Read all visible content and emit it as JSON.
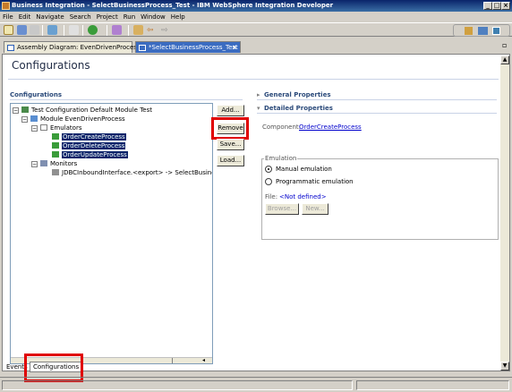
{
  "window": {
    "title": "Business Integration - SelectBusinessProcess_Test - IBM WebSphere Integration Developer",
    "controls": [
      "_",
      "□",
      "×"
    ]
  },
  "menu": [
    "File",
    "Edit",
    "Navigate",
    "Search",
    "Project",
    "Run",
    "Window",
    "Help"
  ],
  "tabs": [
    {
      "label": "Assembly Diagram: EvenDrivenProcess",
      "active": false
    },
    {
      "label": "*SelectBusinessProcess_Test",
      "active": true
    }
  ],
  "editor": {
    "page_title": "Configurations",
    "tree_section_label": "Configurations",
    "tree": [
      {
        "label": "Test Configuration Default Module Test",
        "icon": "config-icon",
        "expander": "⊟"
      },
      {
        "label": "Module EvenDrivenProcess",
        "icon": "module-icon",
        "expander": "⊟"
      },
      {
        "label": "Emulators",
        "icon": "folder-icon",
        "expander": "⊟"
      },
      {
        "label": "OrderCreateProcess",
        "icon": "emulator-icon",
        "selected": true
      },
      {
        "label": "OrderDeleteProcess",
        "icon": "emulator-icon",
        "selected": true
      },
      {
        "label": "OrderUpdateProcess",
        "icon": "emulator-icon",
        "selected": true
      },
      {
        "label": "Monitors",
        "icon": "monitor-icon",
        "expander": "⊟"
      },
      {
        "label": "JDBCInboundInterface.<export> -> SelectBusines",
        "icon": "export-icon"
      }
    ],
    "buttons": {
      "add": "Add...",
      "remove": "Remove",
      "save": "Save...",
      "load": "Load..."
    },
    "general_properties": "General Properties",
    "detailed_properties": "Detailed Properties",
    "component_label": "Component:",
    "component_link": "OrderCreateProcess",
    "emulation_group": "Emulation",
    "manual_emulation": "Manual emulation",
    "programmatic_emulation": "Programmatic emulation",
    "file_label": "File:",
    "file_value": "<Not defined>",
    "browse_button": "Browse...",
    "new_button": "New..."
  },
  "bottom_tabs": [
    "Events",
    "Configurations"
  ],
  "colors": {
    "selection": "#0a246a",
    "annotation": "#e00000",
    "link": "#0000cc",
    "section_heading": "#2b4a7a"
  }
}
